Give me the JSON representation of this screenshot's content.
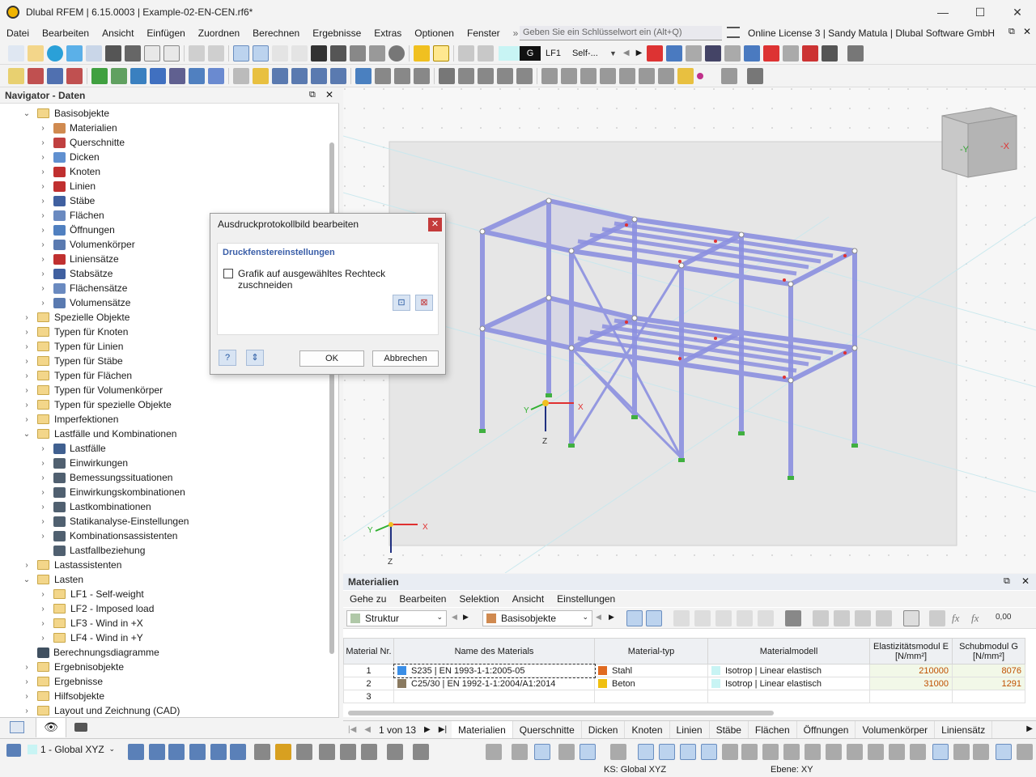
{
  "window": {
    "title": "Dlubal RFEM | 6.15.0003 | Example-02-EN-CEN.rf6*",
    "controls": [
      "—",
      "☐",
      "✕"
    ]
  },
  "menu": [
    "Datei",
    "Bearbeiten",
    "Ansicht",
    "Einfügen",
    "Zuordnen",
    "Berechnen",
    "Ergebnisse",
    "Extras",
    "Optionen",
    "Fenster"
  ],
  "search": {
    "placeholder": "Geben Sie ein Schlüsselwort ein (Alt+Q)"
  },
  "license": "Online License 3 | Sandy Matula | Dlubal Software GmbH",
  "toolbar": {
    "loadcase_color": "G",
    "loadcase_id": "LF1",
    "loadcase_name": "Self-..."
  },
  "navigator": {
    "title": "Navigator - Daten",
    "tree": [
      {
        "label": "Basisobjekte",
        "level": 1,
        "expanded": true,
        "folder": true
      },
      {
        "label": "Materialien",
        "level": 2,
        "icon": "material-icon",
        "color": "#d08a50"
      },
      {
        "label": "Querschnitte",
        "level": 2,
        "icon": "section-icon",
        "color": "#c04040"
      },
      {
        "label": "Dicken",
        "level": 2,
        "icon": "thickness-icon",
        "color": "#6090d0"
      },
      {
        "label": "Knoten",
        "level": 2,
        "icon": "node-icon",
        "color": "#c03030"
      },
      {
        "label": "Linien",
        "level": 2,
        "icon": "line-icon",
        "color": "#c03030"
      },
      {
        "label": "Stäbe",
        "level": 2,
        "icon": "member-icon",
        "color": "#4060a0"
      },
      {
        "label": "Flächen",
        "level": 2,
        "icon": "surface-icon",
        "color": "#6a8ac0"
      },
      {
        "label": "Öffnungen",
        "level": 2,
        "icon": "opening-icon",
        "color": "#5080c0"
      },
      {
        "label": "Volumenkörper",
        "level": 2,
        "icon": "solid-icon",
        "color": "#5a7ab0"
      },
      {
        "label": "Liniensätze",
        "level": 2,
        "icon": "lineset-icon",
        "color": "#c03030"
      },
      {
        "label": "Stabsätze",
        "level": 2,
        "icon": "memberset-icon",
        "color": "#4060a0"
      },
      {
        "label": "Flächensätze",
        "level": 2,
        "icon": "surfaceset-icon",
        "color": "#6a8ac0"
      },
      {
        "label": "Volumensätze",
        "level": 2,
        "icon": "solidset-icon",
        "color": "#5a7ab0"
      },
      {
        "label": "Spezielle Objekte",
        "level": 1,
        "folder": true
      },
      {
        "label": "Typen für Knoten",
        "level": 1,
        "folder": true
      },
      {
        "label": "Typen für Linien",
        "level": 1,
        "folder": true
      },
      {
        "label": "Typen für Stäbe",
        "level": 1,
        "folder": true
      },
      {
        "label": "Typen für Flächen",
        "level": 1,
        "folder": true
      },
      {
        "label": "Typen für Volumenkörper",
        "level": 1,
        "folder": true
      },
      {
        "label": "Typen für spezielle Objekte",
        "level": 1,
        "folder": true
      },
      {
        "label": "Imperfektionen",
        "level": 1,
        "folder": true
      },
      {
        "label": "Lastfälle und Kombinationen",
        "level": 1,
        "expanded": true,
        "folder": true
      },
      {
        "label": "Lastfälle",
        "level": 2,
        "icon": "loadcase-icon",
        "color": "#406090"
      },
      {
        "label": "Einwirkungen",
        "level": 2,
        "icon": "action-icon",
        "color": "#506070"
      },
      {
        "label": "Bemessungssituationen",
        "level": 2,
        "icon": "design-situation-icon",
        "color": "#506070"
      },
      {
        "label": "Einwirkungskombinationen",
        "level": 2,
        "icon": "action-combination-icon",
        "color": "#506070"
      },
      {
        "label": "Lastkombinationen",
        "level": 2,
        "icon": "load-combination-icon",
        "color": "#506070"
      },
      {
        "label": "Statikanalyse-Einstellungen",
        "level": 2,
        "icon": "analysis-settings-icon",
        "color": "#506070"
      },
      {
        "label": "Kombinationsassistenten",
        "level": 2,
        "icon": "combination-wizard-icon",
        "color": "#506070"
      },
      {
        "label": "Lastfallbeziehung",
        "level": 2,
        "icon": "relationship-icon",
        "color": "#506070",
        "noexp": true
      },
      {
        "label": "Lastassistenten",
        "level": 1,
        "folder": true
      },
      {
        "label": "Lasten",
        "level": 1,
        "expanded": true,
        "folder": true
      },
      {
        "label": "LF1 - Self-weight",
        "level": 2,
        "folder": true
      },
      {
        "label": "LF2 - Imposed load",
        "level": 2,
        "folder": true
      },
      {
        "label": "LF3 - Wind in +X",
        "level": 2,
        "folder": true
      },
      {
        "label": "LF4 - Wind in +Y",
        "level": 2,
        "folder": true
      },
      {
        "label": "Berechnungsdiagramme",
        "level": 1,
        "icon": "diagram-icon",
        "color": "#405060",
        "noexp": true
      },
      {
        "label": "Ergebnisobjekte",
        "level": 1,
        "folder": true
      },
      {
        "label": "Ergebnisse",
        "level": 1,
        "folder": true
      },
      {
        "label": "Hilfsobjekte",
        "level": 1,
        "folder": true
      },
      {
        "label": "Layout und Zeichnung (CAD)",
        "level": 1,
        "folder": true
      }
    ]
  },
  "dialog": {
    "title": "Ausdruckprotokollbild bearbeiten",
    "group_title": "Druckfenstereinstellungen",
    "checkbox_label": "Grafik auf ausgewähltes Rechteck zuschneiden",
    "checkbox_checked": false,
    "ok_label": "OK",
    "cancel_label": "Abbrechen"
  },
  "viewport": {
    "axis_x": "X",
    "axis_y": "Y",
    "axis_z": "Z",
    "cube_front": "-Y",
    "cube_right": "-X"
  },
  "materials": {
    "title": "Materialien",
    "menu": [
      "Gehe zu",
      "Bearbeiten",
      "Selektion",
      "Ansicht",
      "Einstellungen"
    ],
    "filter1": "Struktur",
    "filter2": "Basisobjekte",
    "columns": [
      "Material Nr.",
      "Name des Materials",
      "Material-typ",
      "Materialmodell",
      "Elastizitätsmodul E [N/mm²]",
      "Schubmodul G [N/mm²]"
    ],
    "rows": [
      {
        "nr": "1",
        "name": "S235 | EN 1993-1-1:2005-05",
        "name_color": "#3a8ee6",
        "type": "Stahl",
        "type_color": "#e06a20",
        "model": "Isotrop | Linear elastisch",
        "model_color": "#c8f4f4",
        "E": "210000",
        "G": "8076"
      },
      {
        "nr": "2",
        "name": "C25/30 | EN 1992-1-1:2004/A1:2014",
        "name_color": "#8a7a60",
        "type": "Beton",
        "type_color": "#f0c010",
        "model": "Isotrop | Linear elastisch",
        "model_color": "#c8f4f4",
        "E": "31000",
        "G": "1291"
      },
      {
        "nr": "3",
        "name": "",
        "type": "",
        "model": "",
        "E": "",
        "G": ""
      }
    ],
    "pager": "1 von 13",
    "tabs": [
      "Materialien",
      "Querschnitte",
      "Dicken",
      "Knoten",
      "Linien",
      "Stäbe",
      "Flächen",
      "Öffnungen",
      "Volumenkörper",
      "Liniensätz"
    ]
  },
  "status": {
    "coord_system": "1 - Global XYZ",
    "ks": "KS: Global XYZ",
    "plane": "Ebene: XY"
  }
}
